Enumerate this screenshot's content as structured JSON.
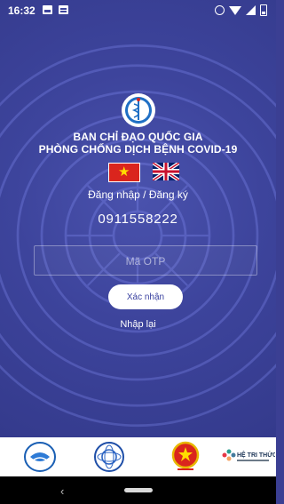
{
  "status_bar": {
    "time": "16:32"
  },
  "header": {
    "org_line1": "BAN CHỈ ĐẠO QUỐC GIA",
    "org_line2": "PHÒNG CHỐNG DỊCH BỆNH COVID-19"
  },
  "languages": [
    {
      "name": "vietnamese-flag",
      "selected": true
    },
    {
      "name": "uk-flag",
      "selected": false
    }
  ],
  "login": {
    "label": "Đăng nhập / Đăng ký",
    "phone_number": "0911558222",
    "otp_placeholder": "Mã OTP",
    "confirm_label": "Xác nhận",
    "reenter_label": "Nhập lại"
  },
  "partners": {
    "knowledge_system_label": "HỆ TRI THỨC"
  },
  "colors": {
    "background": "#3d449c",
    "button_text": "#3a42a0",
    "flag_red": "#da251d",
    "flag_star": "#ffde00"
  },
  "icons": [
    "image-icon",
    "message-icon",
    "alarm-icon",
    "wifi-icon",
    "signal-icon",
    "battery-icon",
    "back-icon",
    "home-icon"
  ]
}
